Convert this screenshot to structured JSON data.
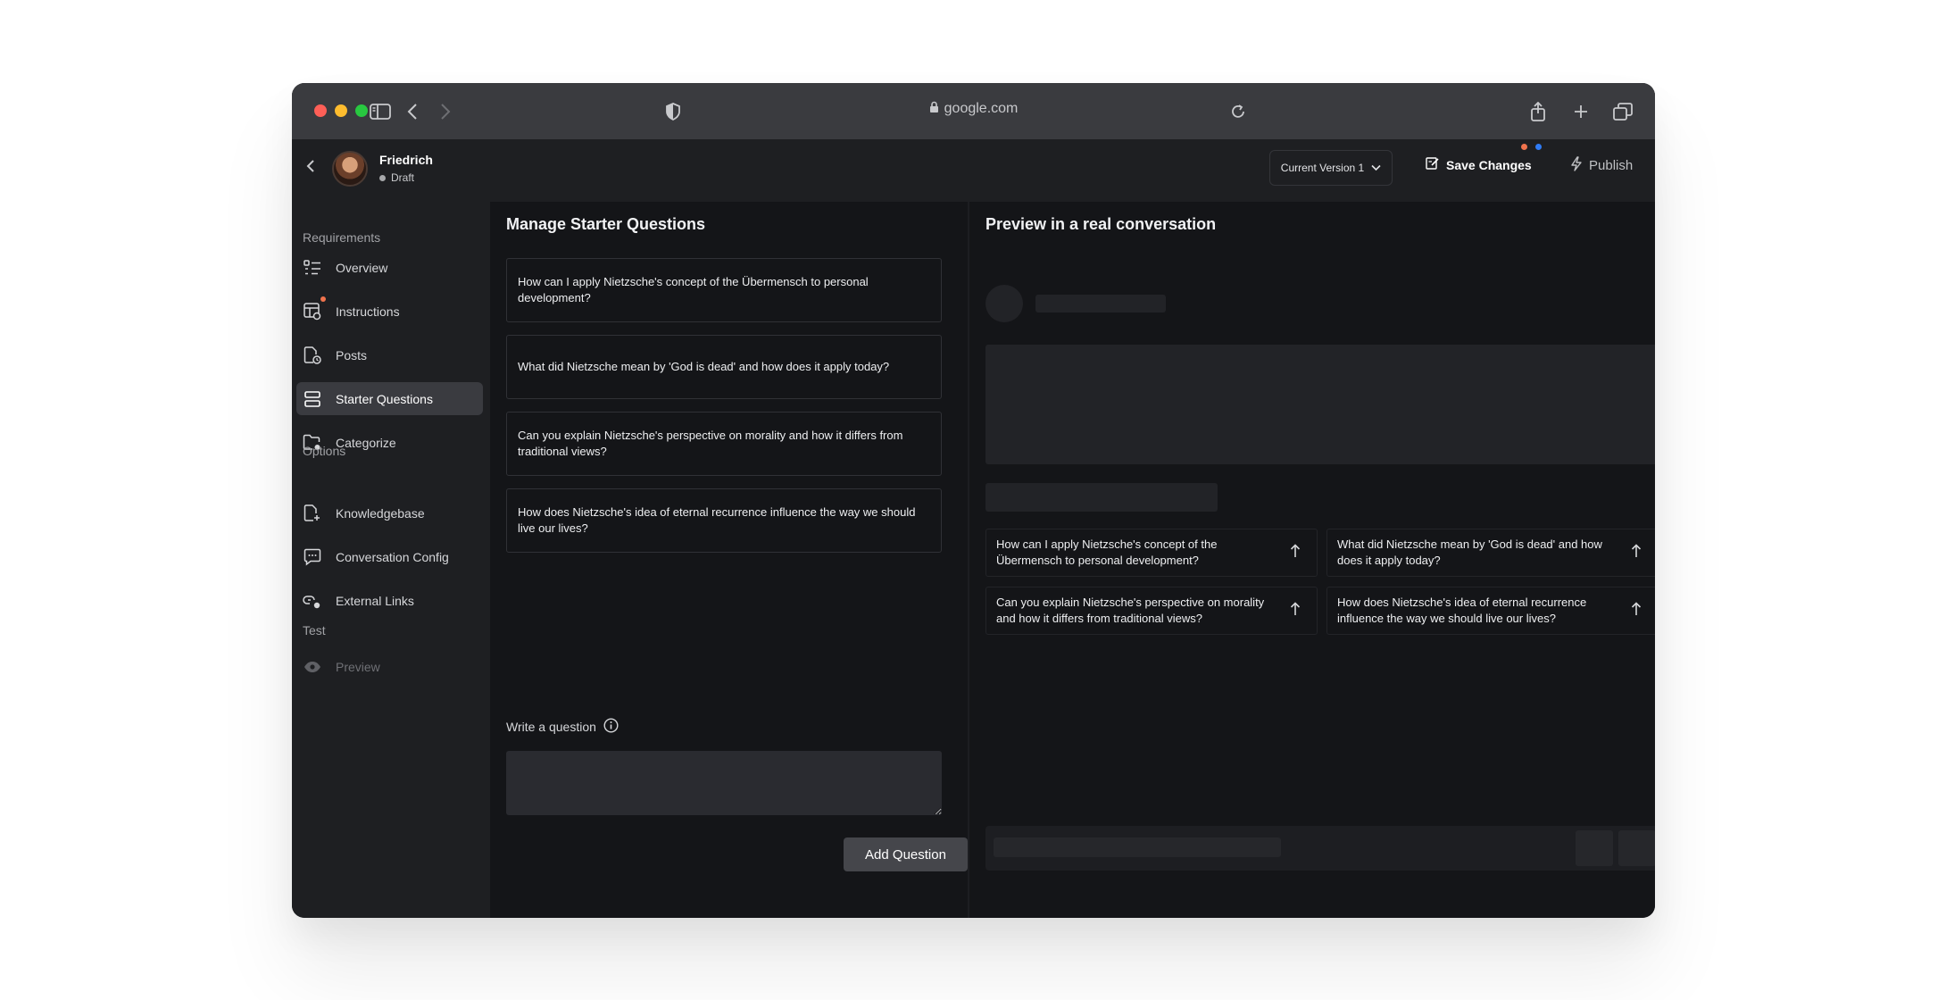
{
  "browser": {
    "url": "google.com"
  },
  "agent": {
    "name": "Friedrich",
    "status": "Draft"
  },
  "header": {
    "version_label": "Current Version 1",
    "save_label": "Save Changes",
    "publish_label": "Publish",
    "notification_colors": [
      "#f0734d",
      "#2f7bf5"
    ]
  },
  "sidebar": {
    "sections": {
      "requirements": "Requirements",
      "options": "Options",
      "test": "Test"
    },
    "items": [
      {
        "label": "Overview",
        "icon": "list-icon"
      },
      {
        "label": "Instructions",
        "icon": "table-settings-icon",
        "badge": true
      },
      {
        "label": "Posts",
        "icon": "document-clock-icon"
      },
      {
        "label": "Starter Questions",
        "icon": "stack-icon",
        "active": true
      },
      {
        "label": "Categorize",
        "icon": "folder-gear-icon"
      },
      {
        "label": "Knowledgebase",
        "icon": "document-plus-icon"
      },
      {
        "label": "Conversation Config",
        "icon": "chat-bubble-icon"
      },
      {
        "label": "External Links",
        "icon": "link-gear-icon"
      },
      {
        "label": "Preview",
        "icon": "eye-icon",
        "disabled": true
      }
    ]
  },
  "manage": {
    "title": "Manage Starter Questions",
    "questions": [
      "How can I apply Nietzsche's concept of the Übermensch to personal development?",
      "What did Nietzsche mean by 'God is dead' and how does it apply today?",
      "Can you explain Nietzsche's perspective on morality and how it differs from traditional views?",
      "How does Nietzsche's idea of eternal recurrence influence the way we should live our lives?"
    ],
    "write_label": "Write a question",
    "input_value": "",
    "add_button": "Add Question"
  },
  "preview": {
    "title": "Preview in a real conversation",
    "questions": [
      "How can I apply Nietzsche's concept of the Übermensch to personal development?",
      "What did Nietzsche mean by 'God is dead' and how does it apply today?",
      "Can you explain Nietzsche's perspective on morality and how it differs from traditional views?",
      "How does Nietzsche's idea of eternal recurrence influence the way we should live our lives?"
    ]
  }
}
